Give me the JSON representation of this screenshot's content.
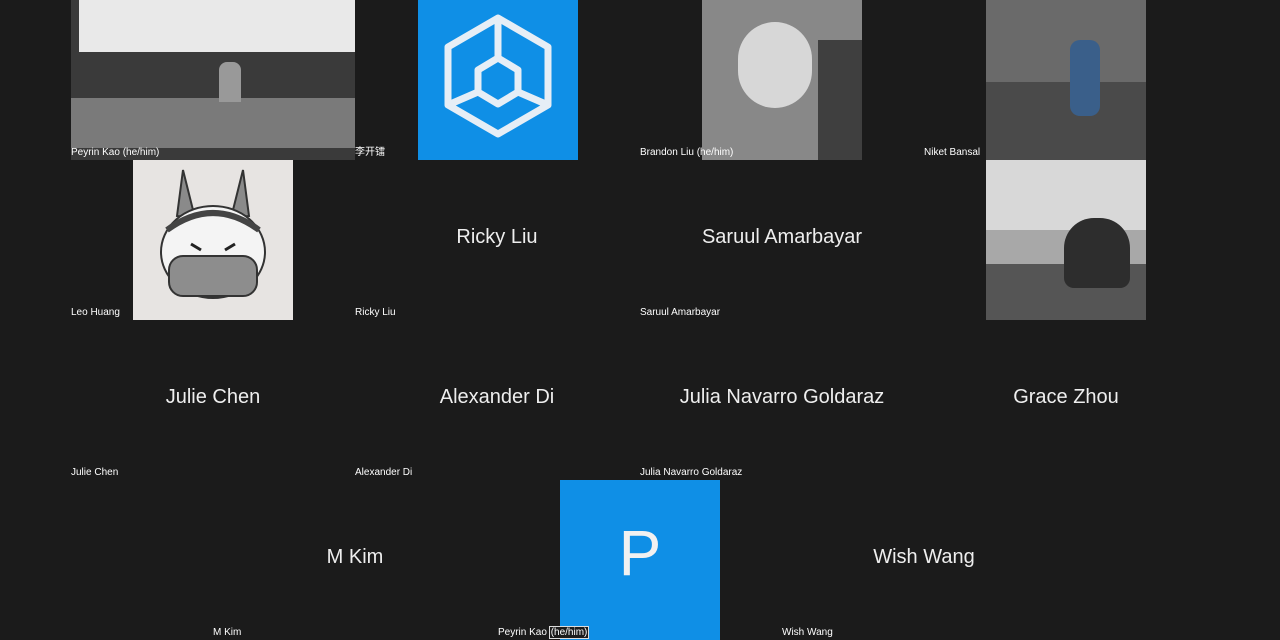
{
  "participants": [
    {
      "id": "p1",
      "tag": "Peyrin Kao (he/him)"
    },
    {
      "id": "p2",
      "tag": "李开镭"
    },
    {
      "id": "p3",
      "tag": "Brandon Liu (he/him)"
    },
    {
      "id": "p4",
      "tag": "Niket Bansal"
    },
    {
      "id": "p5",
      "tag": "Leo Huang"
    },
    {
      "id": "p6",
      "display": "Ricky Liu",
      "tag": "Ricky Liu"
    },
    {
      "id": "p7",
      "display": "Saruul Amarbayar",
      "tag": "Saruul Amarbayar"
    },
    {
      "id": "p8",
      "tag": ""
    },
    {
      "id": "p9",
      "display": "Julie Chen",
      "tag": "Julie Chen"
    },
    {
      "id": "p10",
      "display": "Alexander Di",
      "tag": "Alexander Di"
    },
    {
      "id": "p11",
      "display": "Julia Navarro Goldaraz",
      "tag": "Julia Navarro Goldaraz"
    },
    {
      "id": "p12",
      "display": "Grace Zhou",
      "tag": ""
    },
    {
      "id": "p13",
      "display": "M Kim",
      "tag": "M Kim"
    },
    {
      "id": "p14",
      "avatar_letter": "P",
      "tag_prefix": "Peyrin Kao ",
      "tag_highlight": "(he/him)"
    },
    {
      "id": "p15",
      "display": "Wish Wang",
      "tag": "Wish Wang"
    }
  ],
  "colors": {
    "background": "#1b1b1b",
    "avatar_blue": "#0f8fe6"
  }
}
